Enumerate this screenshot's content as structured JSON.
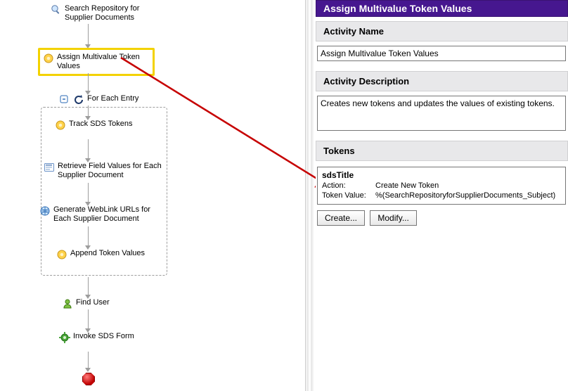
{
  "panel": {
    "title": "Assign Multivalue Token Values",
    "sections": {
      "name_head": "Activity Name",
      "desc_head": "Activity Description",
      "tokens_head": "Tokens"
    },
    "activity_name_value": "Assign Multivalue Token Values",
    "description_value": "Creates new tokens and updates the values of existing tokens.",
    "token": {
      "name": "sdsTitle",
      "action_label": "Action:",
      "action_value": "Create New Token",
      "value_label": "Token Value:",
      "value_value": "%(SearchRepositoryforSupplierDocuments_Subject)"
    },
    "buttons": {
      "create": "Create...",
      "modify": "Modify..."
    }
  },
  "workflow": {
    "n1": "Search Repository for Supplier Documents",
    "n2": "Assign Multivalue Token Values",
    "n3": "For Each Entry",
    "n4": "Track SDS Tokens",
    "n5": "Retrieve Field Values for Each Supplier Document",
    "n6": "Generate WebLink URLs for Each Supplier Document",
    "n7": "Append Token Values",
    "n8": "Find User",
    "n9": "Invoke SDS Form"
  }
}
